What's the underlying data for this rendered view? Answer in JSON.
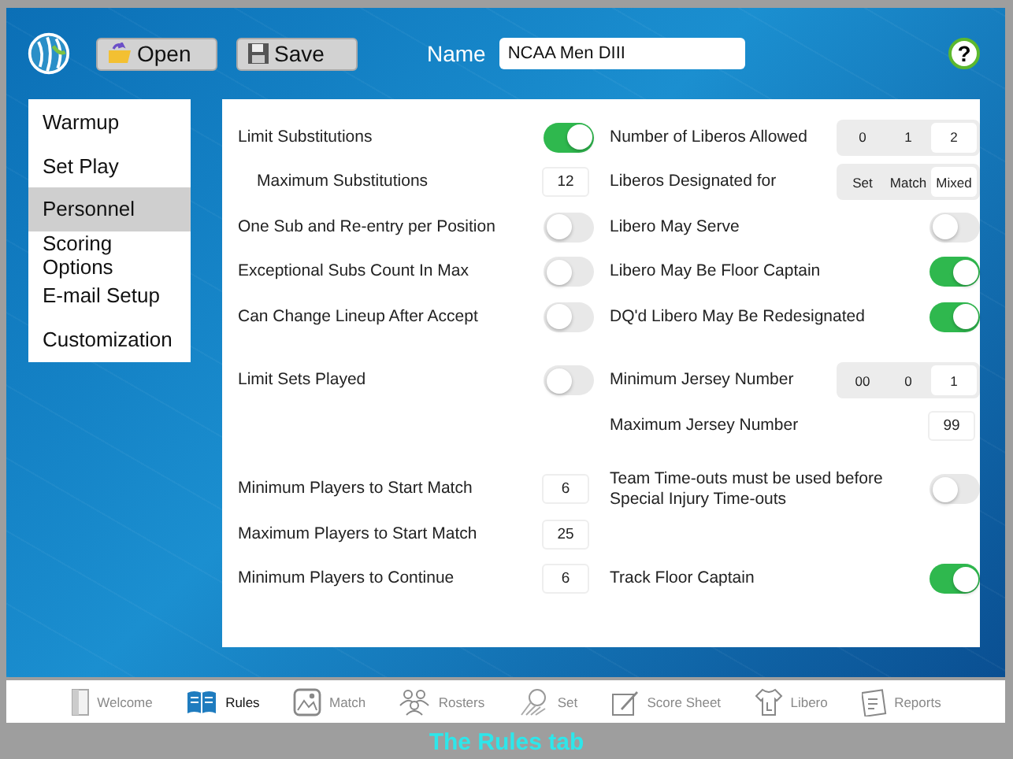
{
  "toolbar": {
    "open": "Open",
    "save": "Save",
    "name_label": "Name",
    "name_value": "NCAA Men DIII",
    "help": "?"
  },
  "sidebar": {
    "items": [
      {
        "label": "Warmup",
        "selected": false
      },
      {
        "label": "Set Play",
        "selected": false
      },
      {
        "label": "Personnel",
        "selected": true
      },
      {
        "label": "Scoring Options",
        "selected": false
      },
      {
        "label": "E-mail Setup",
        "selected": false
      },
      {
        "label": "Customization",
        "selected": false
      }
    ]
  },
  "groups": [
    {
      "rows": [
        {
          "left": {
            "kind": "toggle",
            "label": "Limit Substitutions",
            "on": true
          },
          "right": {
            "kind": "segment",
            "label": "Number of Liberos Allowed",
            "options": [
              {
                "label": "0",
                "selected": false
              },
              {
                "label": "1",
                "selected": false
              },
              {
                "label": "2",
                "selected": true
              }
            ]
          }
        },
        {
          "left": {
            "kind": "subnumber",
            "label": "Maximum Substitutions",
            "value": "12"
          },
          "right": {
            "kind": "segment",
            "label": "Liberos Designated for",
            "options": [
              {
                "label": "Set",
                "selected": false
              },
              {
                "label": "Match",
                "selected": false
              },
              {
                "label": "Mixed",
                "selected": true
              }
            ]
          }
        },
        {
          "left": {
            "kind": "toggle",
            "label": "One Sub and Re-entry per Position",
            "on": false
          },
          "right": {
            "kind": "toggle",
            "label": "Libero May Serve",
            "on": false
          }
        },
        {
          "left": {
            "kind": "toggle",
            "label": "Exceptional Subs Count In Max",
            "on": false
          },
          "right": {
            "kind": "toggle",
            "label": "Libero May Be Floor Captain",
            "on": true
          }
        },
        {
          "left": {
            "kind": "toggle",
            "label": "Can Change Lineup After Accept",
            "on": false
          },
          "right": {
            "kind": "toggle",
            "label": "DQ'd Libero May Be Redesignated",
            "on": true
          }
        }
      ]
    },
    {
      "rows": [
        {
          "left": {
            "kind": "toggle",
            "label": "Limit Sets Played",
            "on": false
          },
          "right": {
            "kind": "segment",
            "label": "Minimum Jersey Number",
            "options": [
              {
                "label": "00",
                "selected": false
              },
              {
                "label": "0",
                "selected": false
              },
              {
                "label": "1",
                "selected": true
              }
            ]
          }
        },
        {
          "right": {
            "kind": "number",
            "label": "Maximum Jersey Number",
            "value": "99"
          }
        }
      ]
    },
    {
      "rows": [
        {
          "left": {
            "kind": "number",
            "label": "Minimum Players to Start Match",
            "value": "6"
          },
          "right": {
            "kind": "toggle",
            "label": "Team Time-outs must be used before Special Injury Time-outs",
            "on": false
          }
        },
        {
          "left": {
            "kind": "number",
            "label": "Maximum Players to Start Match",
            "value": "25"
          }
        },
        {
          "left": {
            "kind": "number",
            "label": "Minimum Players to Continue",
            "value": "6"
          },
          "right": {
            "kind": "toggle",
            "label": "Track Floor Captain",
            "on": true
          }
        }
      ]
    }
  ],
  "tabs": [
    {
      "label": "Welcome",
      "selected": false
    },
    {
      "label": "Rules",
      "selected": true
    },
    {
      "label": "Match",
      "selected": false
    },
    {
      "label": "Rosters",
      "selected": false
    },
    {
      "label": "Set",
      "selected": false
    },
    {
      "label": "Score Sheet",
      "selected": false
    },
    {
      "label": "Libero",
      "selected": false
    },
    {
      "label": "Reports",
      "selected": false
    }
  ],
  "caption": "The Rules tab"
}
